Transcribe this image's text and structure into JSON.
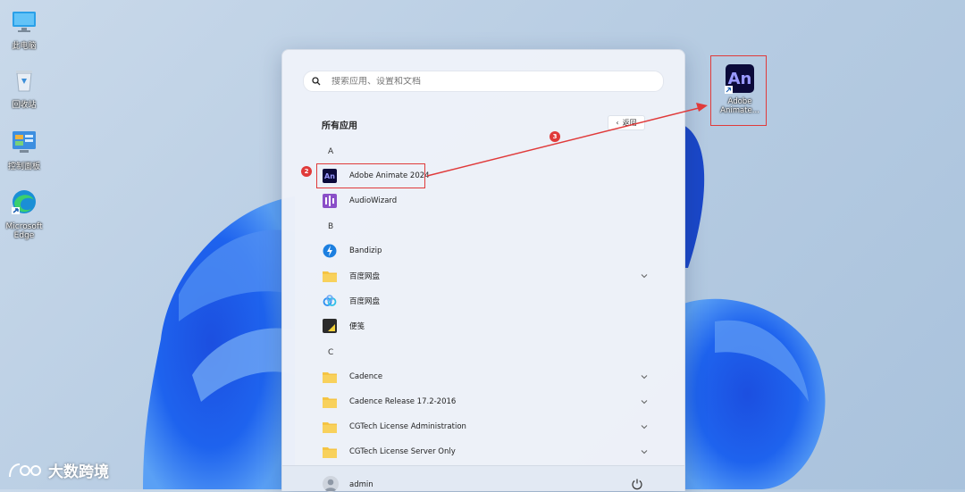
{
  "desktop": {
    "icons": [
      {
        "label": "此电脑",
        "icon": "monitor-icon"
      },
      {
        "label": "回收站",
        "icon": "recycle-bin-icon"
      },
      {
        "label": "控制面板",
        "icon": "control-panel-icon"
      },
      {
        "label": "Microsoft Edge",
        "icon": "edge-icon"
      }
    ],
    "shortcut": {
      "tile_text": "An",
      "label": "Adobe Animate..."
    }
  },
  "start_menu": {
    "search_placeholder": "搜索应用、设置和文档",
    "section_title": "所有应用",
    "back_label": "返回",
    "groups": [
      {
        "letter": "A",
        "apps": [
          {
            "name": "Adobe Animate 2024",
            "icon": "adobe-animate-icon",
            "expandable": false
          },
          {
            "name": "AudioWizard",
            "icon": "audiowizard-icon",
            "expandable": false
          }
        ]
      },
      {
        "letter": "B",
        "apps": [
          {
            "name": "Bandizip",
            "icon": "bandizip-icon",
            "expandable": false
          },
          {
            "name": "百度网盘",
            "icon": "folder-icon",
            "expandable": true
          },
          {
            "name": "百度网盘",
            "icon": "baidu-netdisk-icon",
            "expandable": false
          },
          {
            "name": "便笺",
            "icon": "sticky-notes-icon",
            "expandable": false
          }
        ]
      },
      {
        "letter": "C",
        "apps": [
          {
            "name": "Cadence",
            "icon": "folder-icon",
            "expandable": true
          },
          {
            "name": "Cadence Release 17.2-2016",
            "icon": "folder-icon",
            "expandable": true
          },
          {
            "name": "CGTech License Administration",
            "icon": "folder-icon",
            "expandable": true
          },
          {
            "name": "CGTech License Server Only",
            "icon": "folder-icon",
            "expandable": true
          }
        ]
      }
    ],
    "user": "admin"
  },
  "annotations": {
    "badge_2": "2",
    "badge_3": "3",
    "highlight_color": "#e03a3a"
  },
  "watermark": {
    "text": "大数跨境"
  },
  "colors": {
    "accent": "#0b0a3a",
    "animate_text": "#9999ff",
    "folder": "#f5c443"
  }
}
